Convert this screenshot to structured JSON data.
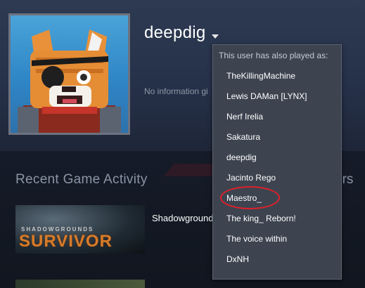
{
  "profile": {
    "username": "deepdig",
    "summary_fragment": "No information gi"
  },
  "activity": {
    "section_title": "Recent Game Activity",
    "hours_fragment": "urs",
    "games": [
      {
        "name": "Shadowgrounds",
        "logo_small": "SHADOWGROUNDS",
        "logo_big": "SURVIVOR"
      }
    ]
  },
  "aliases": {
    "title": "This user has also played as:",
    "items": [
      "TheKillingMachine",
      "Lewis DAMan [LYNX]",
      "Nerf Irelia",
      "Sakatura",
      "deepdig",
      "Jacinto Rego",
      "Maestro_",
      "The king_ Reborn!",
      "The voice within",
      "DxNH"
    ],
    "circled_item": "Maestro_"
  },
  "colors": {
    "background": "#1b2232",
    "dropdown_bg": "#3d4450",
    "annotation_red": "#e0202a"
  },
  "icons": {
    "caret": "chevron-down-icon"
  }
}
